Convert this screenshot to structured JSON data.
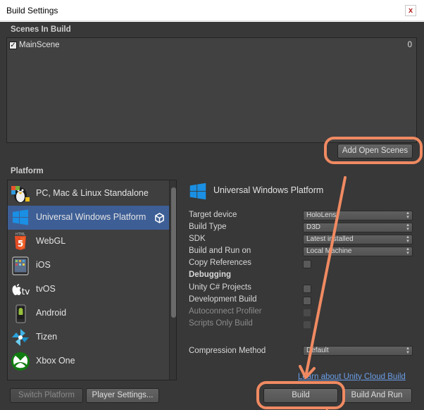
{
  "window": {
    "title": "Build Settings",
    "close_glyph": "x"
  },
  "scenes": {
    "header": "Scenes In Build",
    "items": [
      {
        "name": "MainScene",
        "index": "0",
        "checked": true
      }
    ],
    "add_open_scenes_label": "Add Open Scenes"
  },
  "platform": {
    "header": "Platform",
    "items": [
      {
        "label": "PC, Mac & Linux Standalone",
        "icon": "standalone-penguin-icon"
      },
      {
        "label": "Universal Windows Platform",
        "icon": "windows-logo-icon",
        "selected": true
      },
      {
        "label": "WebGL",
        "icon": "html5-icon"
      },
      {
        "label": "iOS",
        "icon": "ipad-icon"
      },
      {
        "label": "tvOS",
        "icon": "apple-tv-icon"
      },
      {
        "label": "Android",
        "icon": "android-phone-icon"
      },
      {
        "label": "Tizen",
        "icon": "tizen-pinwheel-icon"
      },
      {
        "label": "Xbox One",
        "icon": "xbox-icon"
      }
    ],
    "tvos_tv_text": "tv",
    "html5_badge_text": "5"
  },
  "detail": {
    "title": "Universal Windows Platform",
    "target_device_label": "Target device",
    "target_device_value": "HoloLens",
    "build_type_label": "Build Type",
    "build_type_value": "D3D",
    "sdk_label": "SDK",
    "sdk_value": "Latest installed",
    "build_and_run_on_label": "Build and Run on",
    "build_and_run_on_value": "Local Machine",
    "copy_references_label": "Copy References",
    "debugging_label": "Debugging",
    "unity_csharp_projects_label": "Unity C# Projects",
    "development_build_label": "Development Build",
    "autoconnect_profiler_label": "Autoconnect Profiler",
    "scripts_only_build_label": "Scripts Only Build",
    "compression_method_label": "Compression Method",
    "compression_method_value": "Default"
  },
  "footer": {
    "cloud_link": "Learn about Unity Cloud Build",
    "switch_platform_label": "Switch Platform",
    "player_settings_label": "Player Settings...",
    "build_label": "Build",
    "build_and_run_label": "Build And Run"
  },
  "colors": {
    "annotation": "#f08a62",
    "selection": "#3e5f96",
    "panel": "#383838",
    "link": "#6a9ee8"
  }
}
